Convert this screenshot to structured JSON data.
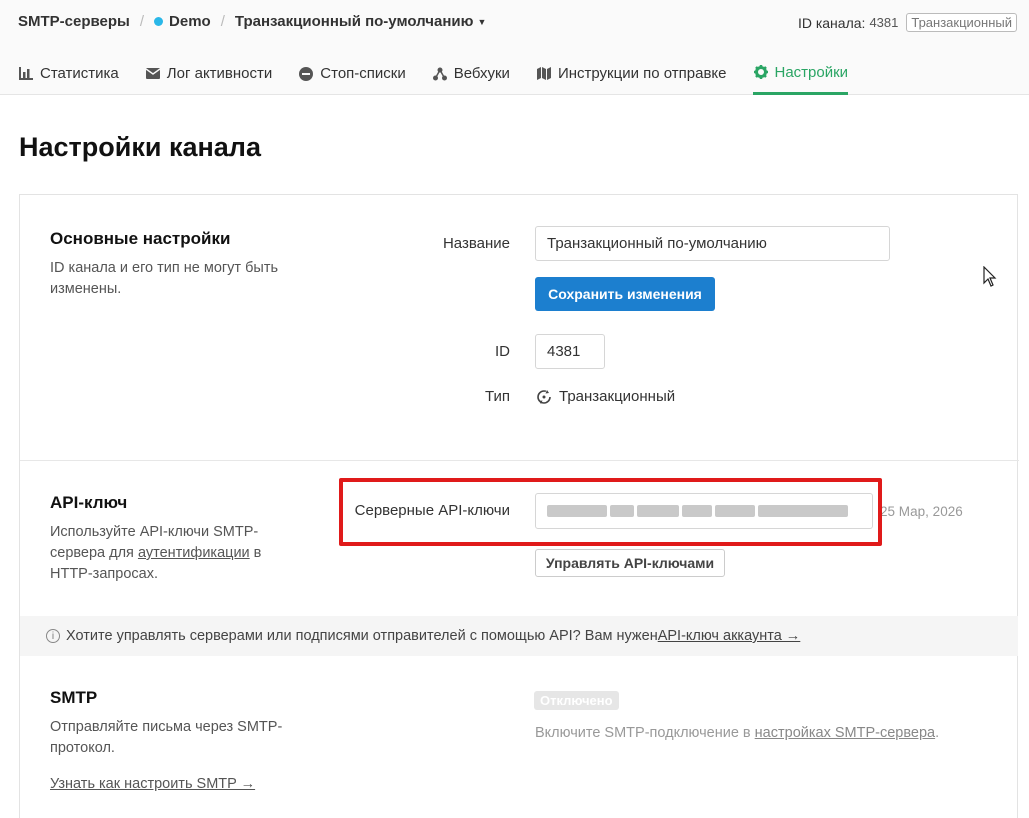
{
  "breadcrumb": {
    "root": "SMTP-серверы",
    "server": "Demo",
    "channel": "Транзакционный по-умолчанию"
  },
  "channel_id": {
    "label": "ID канала:",
    "value": "4381",
    "type_badge": "Транзакционный"
  },
  "tabs": [
    {
      "label": "Статистика",
      "icon": "chart-icon"
    },
    {
      "label": "Лог активности",
      "icon": "envelope-icon"
    },
    {
      "label": "Стоп-списки",
      "icon": "minus-circle-icon"
    },
    {
      "label": "Вебхуки",
      "icon": "webhook-icon"
    },
    {
      "label": "Инструкции по отправке",
      "icon": "map-icon"
    },
    {
      "label": "Настройки",
      "icon": "gear-icon",
      "active": true
    }
  ],
  "page_title": "Настройки канала",
  "basic": {
    "title": "Основные настройки",
    "desc_line1": "ID канала и его тип не могут быть",
    "desc_line2": "изменены.",
    "name_label": "Название",
    "name_value": "Транзакционный по-умолчанию",
    "save_label": "Сохранить изменения",
    "id_label": "ID",
    "id_value": "4381",
    "type_label": "Тип",
    "type_value": "Транзакционный"
  },
  "api": {
    "title": "API-ключ",
    "desc_line1": "Используйте API-ключи SMTP-",
    "desc_line2_pre": "сервера для ",
    "desc_link": "аутентификации",
    "desc_line2_post": " в",
    "desc_line3": "HTTP-запросах.",
    "keys_label": "Серверные API-ключи",
    "key_date": "25 Мар, 2026",
    "manage_label": "Управлять API-ключами"
  },
  "info": {
    "text": "Хотите управлять серверами или подписями отправителей с помощью API? Вам нужен ",
    "link": "API-ключ аккаунта →"
  },
  "smtp": {
    "title": "SMTP",
    "desc_line1": "Отправляйте письма через SMTP-",
    "desc_line2": "протокол.",
    "learn_link": "Узнать как настроить SMTP →",
    "status_badge": "Отключено",
    "hint_pre": "Включите SMTP-подключение в ",
    "hint_link": "настройках SMTP-сервера",
    "hint_post": "."
  },
  "colors": {
    "accent_green": "#2aa564",
    "primary_blue": "#1c7fcf",
    "highlight_red": "#e01a1a"
  }
}
